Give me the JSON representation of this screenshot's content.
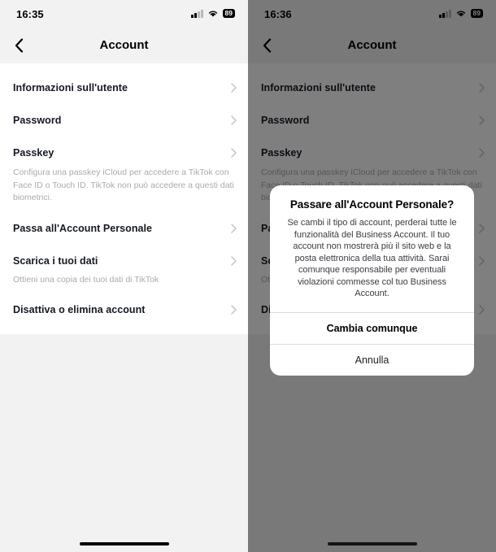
{
  "screens": [
    {
      "id": "account-settings",
      "status_bar": {
        "time": "16:35",
        "battery": "89",
        "signal_icon": "cellular-signal-icon",
        "wifi_icon": "wifi-icon",
        "battery_icon": "battery-icon"
      },
      "nav": {
        "back_icon": "chevron-left-icon",
        "title": "Account"
      },
      "rows": [
        {
          "label": "Informazioni sull'utente",
          "chevron": "chevron-right-icon"
        },
        {
          "label": "Password",
          "chevron": "chevron-right-icon"
        },
        {
          "label": "Passkey",
          "chevron": "chevron-right-icon",
          "description": "Configura una passkey iCloud per accedere a TikTok con Face ID o Touch ID. TikTok non può accedere a questi dati biometrici."
        },
        {
          "label": "Passa all'Account Personale",
          "chevron": "chevron-right-icon"
        },
        {
          "label": "Scarica i tuoi dati",
          "chevron": "chevron-right-icon",
          "subtitle": "Ottieni una copia dei tuoi dati di TikTok"
        },
        {
          "label": "Disattiva o elimina account",
          "chevron": "chevron-right-icon"
        }
      ],
      "home_indicator": "home-indicator"
    },
    {
      "id": "account-settings-with-alert",
      "status_bar": {
        "time": "16:36",
        "battery": "89",
        "signal_icon": "cellular-signal-icon",
        "wifi_icon": "wifi-icon",
        "battery_icon": "battery-icon"
      },
      "nav": {
        "back_icon": "chevron-left-icon",
        "title": "Account"
      },
      "rows": [
        {
          "label": "Informazioni sull'utente",
          "chevron": "chevron-right-icon"
        },
        {
          "label": "Password",
          "chevron": "chevron-right-icon"
        },
        {
          "label": "Passkey",
          "chevron": "chevron-right-icon",
          "description": "Configura una passkey iCloud per accedere a TikTok con Face ID o Touch ID. TikTok non può accedere a questi dati biometrici."
        },
        {
          "label": "Passa all'Account Personale",
          "chevron": "chevron-right-icon"
        },
        {
          "label": "Scarica i tuoi dati",
          "chevron": "chevron-right-icon",
          "subtitle": "Ottieni una copia dei tuoi dati di TikTok"
        },
        {
          "label": "Disattiva o elimina account",
          "chevron": "chevron-right-icon"
        }
      ],
      "alert": {
        "title": "Passare all'Account Personale?",
        "message": "Se cambi il tipo di account, perderai tutte le funzionalità del Business Account. Il tuo account non mostrerà più il sito web e la posta elettronica della tua attività. Sarai comunque responsabile per eventuali violazioni commesse col tuo Business Account.",
        "confirm_label": "Cambia comunque",
        "cancel_label": "Annulla"
      },
      "home_indicator": "home-indicator"
    }
  ],
  "colors": {
    "card_background": "#ffffff",
    "page_background": "#f2f2f2",
    "primary_text": "#161823",
    "secondary_text": "#a9abb0",
    "chevron": "#c4c4c6",
    "dim_overlay": "#808080"
  }
}
